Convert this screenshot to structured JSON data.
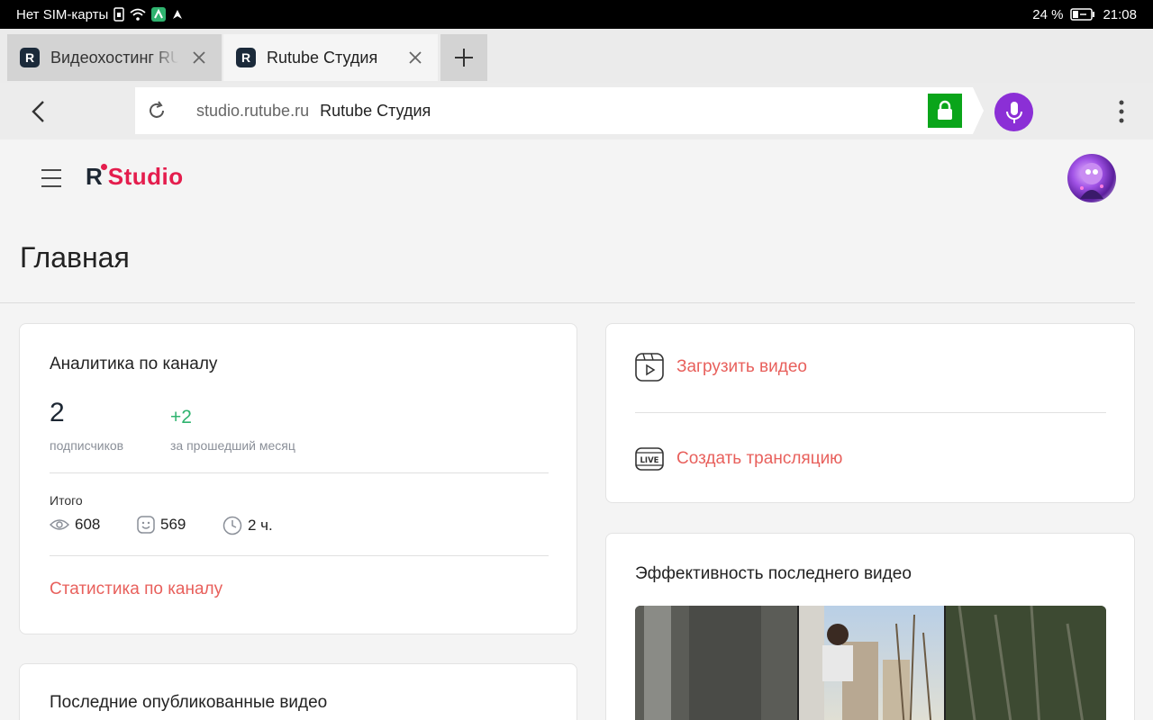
{
  "status_bar": {
    "carrier": "Нет SIM-карты",
    "battery": "24 %",
    "time": "21:08"
  },
  "browser": {
    "tabs": [
      {
        "title": "Видеохостинг RUTUBE",
        "favicon": "R",
        "active": false
      },
      {
        "title": "Rutube Студия",
        "favicon": "R",
        "active": true
      }
    ],
    "address": {
      "domain": "studio.rutube.ru",
      "page_title": "Rutube Студия"
    }
  },
  "app": {
    "logo_r": "R",
    "logo_studio": "Studio",
    "page_heading": "Главная"
  },
  "analytics": {
    "title": "Аналитика по каналу",
    "subscribers": "2",
    "subscribers_caption": "подписчиков",
    "growth": "+2",
    "growth_caption": "за прошедший месяц",
    "total_label": "Итого",
    "views": "608",
    "reactions": "569",
    "watch_time": "2 ч.",
    "stats_link": "Статистика по каналу"
  },
  "actions": {
    "upload": "Загрузить видео",
    "live": "Создать трансляцию",
    "live_icon_text": "LIVE"
  },
  "performance": {
    "title": "Эффективность последнего видео"
  },
  "recent": {
    "title": "Последние опубликованные видео"
  },
  "colors": {
    "accent_red": "#e8605c",
    "brand_red": "#e41d4d",
    "growth_green": "#2fb36f",
    "mic_purple": "#8b2fd6",
    "lock_green": "#0aa51a"
  }
}
